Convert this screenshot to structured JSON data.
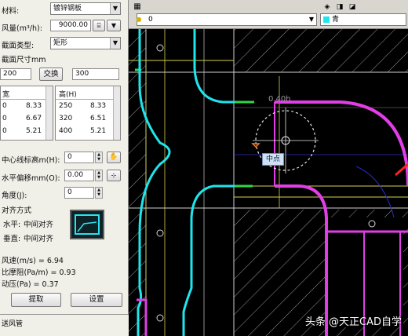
{
  "panel": {
    "material_label": "材料:",
    "material_value": "镀锌钢板",
    "airflow_label": "风量(m³/h):",
    "airflow_value": "9000.00",
    "section_label": "截面类型:",
    "section_value": "矩形",
    "size_label": "截面尺寸mm",
    "width_value": "200",
    "swap_label": "交换",
    "height_value": "300",
    "width_col_header": "宽",
    "height_col_header": "高(H)",
    "width_rows": [
      {
        "size": "0",
        "velocity": "8.33"
      },
      {
        "size": "0",
        "velocity": "6.67"
      },
      {
        "size": "0",
        "velocity": "5.21"
      }
    ],
    "height_rows": [
      {
        "size": "250",
        "velocity": "8.33"
      },
      {
        "size": "320",
        "velocity": "6.51"
      },
      {
        "size": "400",
        "velocity": "5.21"
      }
    ],
    "elevation_label": "中心线标高m(H):",
    "elevation_value": "0",
    "offset_label": "水平偏移mm(O):",
    "offset_value": "0.00",
    "angle_label": "角度(J):",
    "angle_value": "0",
    "align_title": "对齐方式",
    "horizontal_label": "水平:",
    "horizontal_value": "中间对齐",
    "vertical_label": "垂直:",
    "vertical_value": "中间对齐",
    "velocity_line": "风速(m/s) = 6.94",
    "pressure_line": "比摩阻(Pa/m) = 0.93",
    "dynamic_line": "动压(Pa) = 0.37",
    "pick_button": "提取",
    "settings_button": "设置",
    "bottom_label": "送风管"
  },
  "toolbar": {
    "layer_value": "0",
    "color_value": "青"
  },
  "canvas": {
    "tooltip": "中点",
    "dim_text": "0.40h"
  },
  "watermark": "头条 @天正CAD自学",
  "colors": {
    "duct_cyan": "#1ee6ee",
    "duct_magenta": "#e23ee8",
    "hatch": "#d9d9d9",
    "yellow": "#e0d64a",
    "green": "#2ed84a"
  }
}
